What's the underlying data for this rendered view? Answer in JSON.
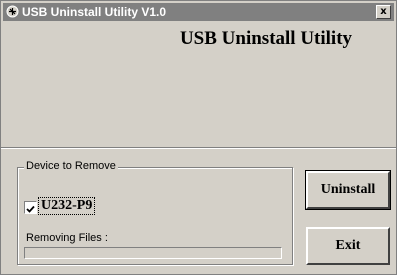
{
  "window": {
    "title": "USB Uninstall Utility V1.0",
    "close_label": "x"
  },
  "heading": "USB Uninstall Utility",
  "device_group": {
    "legend": "Device to Remove",
    "checkbox_checked": true,
    "device_label": "U232-P9"
  },
  "progress": {
    "label": "Removing Files :",
    "value_fraction": 0
  },
  "buttons": {
    "uninstall": "Uninstall",
    "exit": "Exit"
  },
  "icons": {
    "app": "usb-app-icon",
    "close": "close-icon",
    "check": "checkmark-icon"
  }
}
